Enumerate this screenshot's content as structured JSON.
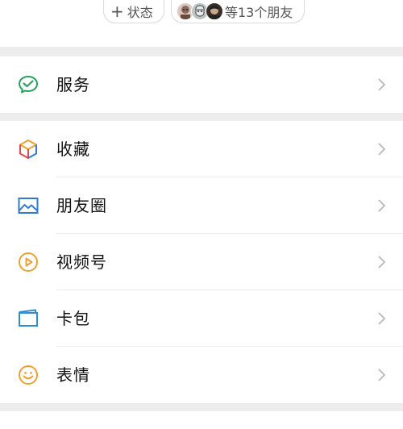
{
  "status_pill": {
    "plus": "+",
    "label": "状态"
  },
  "friends_pill": {
    "label": "等13个朋友"
  },
  "group1": [
    {
      "name": "services",
      "label": "服务",
      "icon": "wechat-pay-icon",
      "color": "#22a55b"
    }
  ],
  "group2": [
    {
      "name": "favorites",
      "label": "收藏",
      "icon": "cube-icon"
    },
    {
      "name": "moments",
      "label": "朋友圈",
      "icon": "picture-icon",
      "color": "#2e7bd1"
    },
    {
      "name": "channels",
      "label": "视频号",
      "icon": "play-circle-icon",
      "color": "#f0a030"
    },
    {
      "name": "cards",
      "label": "卡包",
      "icon": "card-icon",
      "color": "#2d8fd0"
    },
    {
      "name": "stickers",
      "label": "表情",
      "icon": "smiley-icon",
      "color": "#f0a030"
    }
  ]
}
